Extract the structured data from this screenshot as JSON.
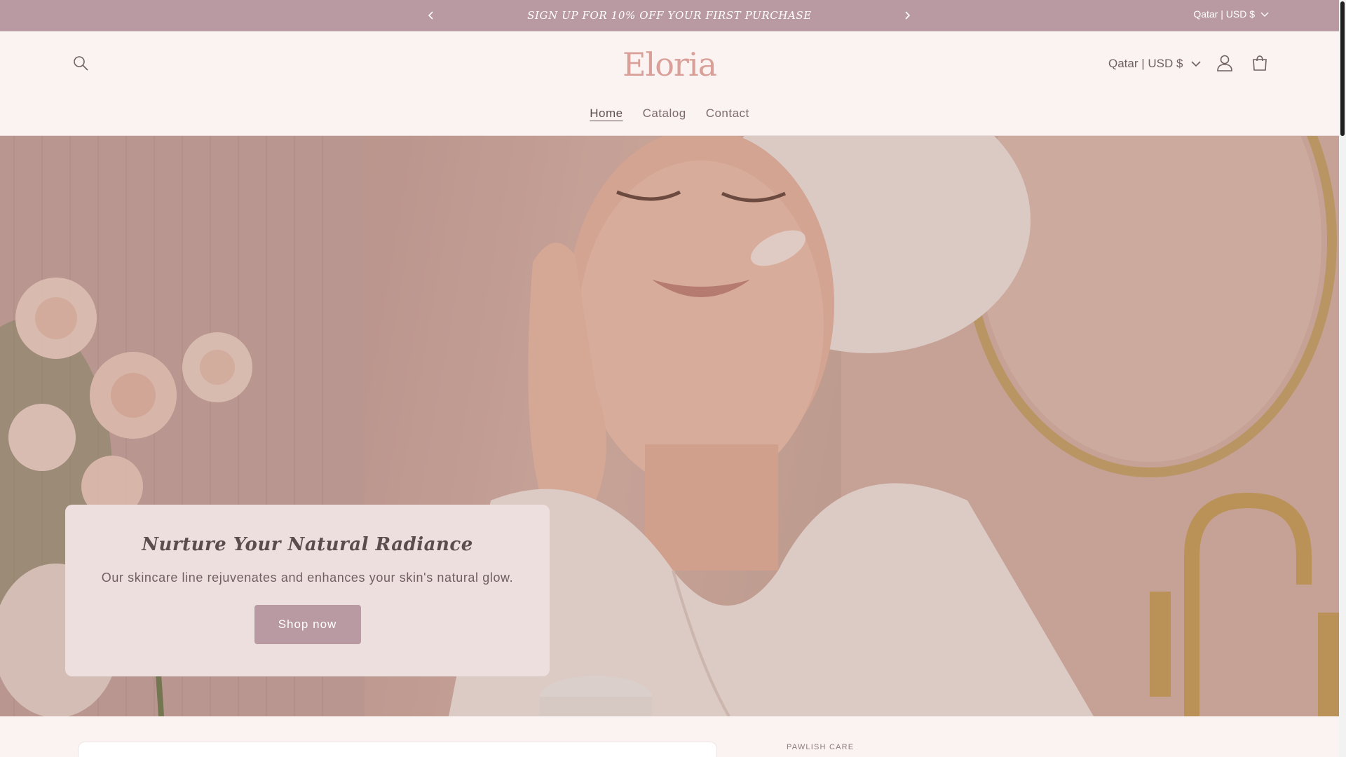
{
  "announcement": {
    "text": "SIGN UP FOR 10% OFF YOUR FIRST PURCHASE",
    "country_selector": "Qatar | USD $"
  },
  "header": {
    "logo_text": "Eloria",
    "country_selector": "Qatar | USD $",
    "nav": [
      {
        "label": "Home",
        "active": true
      },
      {
        "label": "Catalog",
        "active": false
      },
      {
        "label": "Contact",
        "active": false
      }
    ]
  },
  "hero": {
    "title": "Nurture Your Natural Radiance",
    "subtitle": "Our skincare line rejuvenates and enhances your skin's natural glow.",
    "cta_label": "Shop now"
  },
  "below": {
    "section_label": "PAWLISH CARE"
  },
  "colors": {
    "accent": "#b99aa2",
    "logo": "#d9a099",
    "background": "#fbf3f1",
    "card": "#eedfdf"
  },
  "icons": [
    "chevron-left-icon",
    "chevron-right-icon",
    "chevron-down-icon",
    "search-icon",
    "user-icon",
    "cart-icon"
  ]
}
